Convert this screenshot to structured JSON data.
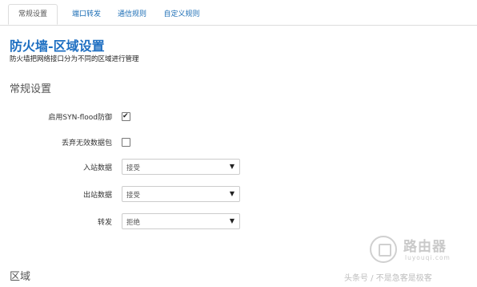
{
  "tabs": [
    {
      "label": "常规设置",
      "active": true
    },
    {
      "label": "端口转发",
      "active": false
    },
    {
      "label": "通信规则",
      "active": false
    },
    {
      "label": "自定义规则",
      "active": false
    }
  ],
  "page": {
    "title": "防火墙-区域设置",
    "description": "防火墙把网络接口分为不同的区域进行管理"
  },
  "general": {
    "section_title": "常规设置",
    "syn_flood": {
      "label": "启用SYN-flood防御",
      "checked": true
    },
    "drop_invalid": {
      "label": "丢弃无效数据包",
      "checked": false
    },
    "input": {
      "label": "入站数据",
      "value": "接受"
    },
    "output": {
      "label": "出站数据",
      "value": "接受"
    },
    "forward": {
      "label": "转发",
      "value": "拒绝"
    }
  },
  "zones": {
    "section_title": "区域"
  },
  "watermark": {
    "brand": "路由器",
    "domain": "luyouqi.com",
    "caption": "头条号 / 不是急客是极客"
  },
  "icons": {
    "checkmark": "checkmark-icon",
    "dropdown": "caret-down-icon"
  }
}
